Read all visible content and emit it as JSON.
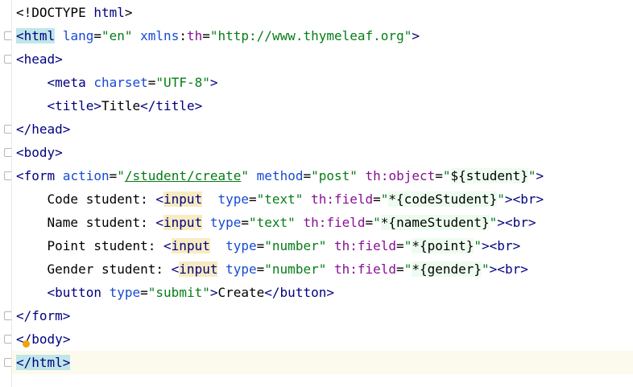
{
  "editor": {
    "lines": [
      "<!DOCTYPE html>",
      "<html lang=\"en\" xmlns:th=\"http://www.thymeleaf.org\">",
      "<head>",
      "    <meta charset=\"UTF-8\">",
      "    <title>Title</title>",
      "</head>",
      "<body>",
      "<form action=\"/student/create\" method=\"post\" th:object=\"${student}\">",
      "    Code student: <input  type=\"text\" th:field=\"*{codeStudent}\"><br>",
      "    Name student: <input type=\"text\" th:field=\"*{nameStudent}\"><br>",
      "    Point student: <input  type=\"number\" th:field=\"*{point}\"><br>",
      "    Gender student: <input type=\"number\" th:field=\"*{gender}\"><br>",
      "    <button type=\"submit\">Create</button>",
      "</form>",
      "</body>",
      "</html>"
    ]
  },
  "tokens": {
    "l0": {
      "a": "<!DOCTYPE ",
      "b": "html",
      "c": ">"
    },
    "l1": {
      "open": "<",
      "tag": "html",
      "sp1": " ",
      "lang": "lang",
      "eq1": "=",
      "langv": "\"en\"",
      "sp2": " ",
      "xmlns": "xmlns",
      "colon": ":",
      "th": "th",
      "eq2": "=",
      "url": "\"http://www.thymeleaf.org\"",
      "close": ">"
    },
    "l2": {
      "open": "<",
      "tag": "head",
      "close": ">"
    },
    "l3": {
      "ind": "    ",
      "open": "<",
      "tag": "meta",
      "sp": " ",
      "attr": "charset",
      "eq": "=",
      "val": "\"UTF-8\"",
      "close": ">"
    },
    "l4": {
      "ind": "    ",
      "open": "<",
      "tag": "title",
      "close": ">",
      "text": "Title",
      "eopen": "</",
      "etag": "title",
      "eclose": ">"
    },
    "l5": {
      "open": "</",
      "tag": "head",
      "close": ">"
    },
    "l6": {
      "open": "<",
      "tag": "body",
      "close": ">"
    },
    "l7": {
      "open": "<",
      "tag": "form",
      "sp1": " ",
      "action": "action",
      "eq1": "=",
      "q1": "\"",
      "path": "/student/create",
      "q2": "\"",
      "sp2": " ",
      "method": "method",
      "eq2": "=",
      "methodv": "\"post\"",
      "sp3": " ",
      "thobj": "th:object",
      "eq3": "=",
      "q3": "\"",
      "expr": "${student}",
      "q4": "\"",
      "close": ">"
    },
    "l8": {
      "ind": "    ",
      "label": "Code student: ",
      "open": "<",
      "tag": "input",
      "sp1": "  ",
      "type": "type",
      "eq1": "=",
      "typev": "\"text\"",
      "sp2": " ",
      "thf": "th:field",
      "eq2": "=",
      "q1": "\"",
      "expr": "*{codeStudent}",
      "q2": "\"",
      "close": ">",
      "br": "<br>"
    },
    "l9": {
      "ind": "    ",
      "label": "Name student: ",
      "open": "<",
      "tag": "input",
      "sp1": " ",
      "type": "type",
      "eq1": "=",
      "typev": "\"text\"",
      "sp2": " ",
      "thf": "th:field",
      "eq2": "=",
      "q1": "\"",
      "expr": "*{nameStudent}",
      "q2": "\"",
      "close": ">",
      "br": "<br>"
    },
    "l10": {
      "ind": "    ",
      "label": "Point student: ",
      "open": "<",
      "tag": "input",
      "sp1": "  ",
      "type": "type",
      "eq1": "=",
      "typev": "\"number\"",
      "sp2": " ",
      "thf": "th:field",
      "eq2": "=",
      "q1": "\"",
      "expr": "*{point}",
      "q2": "\"",
      "close": ">",
      "br": "<br>"
    },
    "l11": {
      "ind": "    ",
      "label": "Gender student: ",
      "open": "<",
      "tag": "input",
      "sp1": " ",
      "type": "type",
      "eq1": "=",
      "typev": "\"number\"",
      "sp2": " ",
      "thf": "th:field",
      "eq2": "=",
      "q1": "\"",
      "expr": "*{gender}",
      "q2": "\"",
      "close": ">",
      "br": "<br>"
    },
    "l12": {
      "ind": "    ",
      "open": "<",
      "tag": "button",
      "sp": " ",
      "type": "type",
      "eq": "=",
      "typev": "\"submit\"",
      "close": ">",
      "text": "Create",
      "eopen": "</",
      "etag": "button",
      "eclose": ">"
    },
    "l13": {
      "open": "</",
      "tag": "form",
      "close": ">"
    },
    "l14": {
      "open": "<",
      "slash": "/",
      "tag": "body",
      "close": ">"
    },
    "l15": {
      "open": "</",
      "tag": "html",
      "close": ">"
    }
  },
  "colors": {
    "tag": "#000080",
    "attribute": "#174ad4",
    "namespace": "#871094",
    "string": "#067d17",
    "tag_match_highlight": "#bfe6e8",
    "input_highlight": "#f7ebc2",
    "current_line": "#fcfaed"
  },
  "icons": [
    "fold-marker-icon",
    "intention-bulb-icon"
  ]
}
